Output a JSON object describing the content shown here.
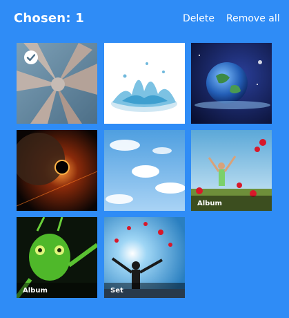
{
  "header": {
    "title": "Chosen: 1",
    "delete_label": "Delete",
    "remove_all_label": "Remove all"
  },
  "colors": {
    "background": "#2f8cf6",
    "text": "#ffffff"
  },
  "tiles": [
    {
      "subject": "hands-together",
      "selected": true,
      "caption": ""
    },
    {
      "subject": "water-splash",
      "selected": false,
      "caption": ""
    },
    {
      "subject": "earth-from-space",
      "selected": false,
      "caption": ""
    },
    {
      "subject": "planet-eclipse",
      "selected": false,
      "caption": ""
    },
    {
      "subject": "blue-sky-clouds",
      "selected": false,
      "caption": ""
    },
    {
      "subject": "person-poppy-field",
      "selected": false,
      "caption": "Album"
    },
    {
      "subject": "green-grasshopper",
      "selected": false,
      "caption": "Album"
    },
    {
      "subject": "person-arms-raised-sun",
      "selected": false,
      "caption": "Set"
    }
  ]
}
